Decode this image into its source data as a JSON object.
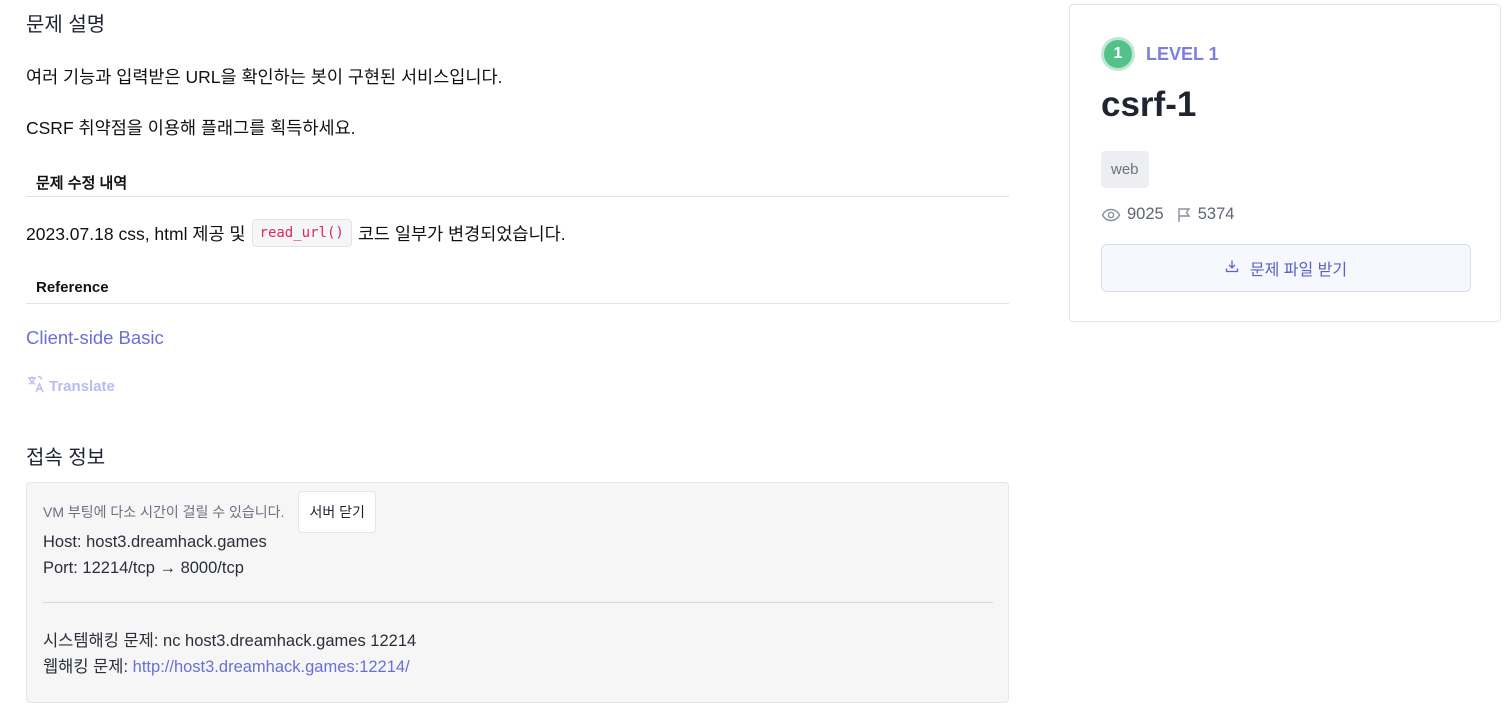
{
  "description": {
    "heading": "문제 설명",
    "line1": "여러 기능과 입력받은 URL을 확인하는 봇이 구현된 서비스입니다.",
    "line2": "CSRF 취약점을 이용해 플래그를 획득하세요."
  },
  "revision": {
    "heading": "문제 수정 내역",
    "text_before": "2023.07.18 css, html 제공 및",
    "code": "read_url()",
    "text_after": "코드 일부가 변경되었습니다."
  },
  "reference": {
    "heading": "Reference",
    "link_label": "Client-side Basic"
  },
  "translate_label": "Translate",
  "connection": {
    "heading": "접속 정보",
    "vm_note": "VM 부팅에 다소 시간이 걸릴 수 있습니다.",
    "close_button": "서버 닫기",
    "host": "Host: host3.dreamhack.games",
    "port": "Port:  12214/tcp → 8000/tcp",
    "system_hacking": "시스템해킹 문제: nc host3.dreamhack.games 12214",
    "web_hacking_label": "웹해킹 문제:",
    "web_hacking_url": "http://host3.dreamhack.games:12214/"
  },
  "sidebar": {
    "level_number": "1",
    "level_label": "LEVEL 1",
    "title": "csrf-1",
    "tag": "web",
    "views": "9025",
    "solves": "5374",
    "download_button": "문제 파일 받기"
  },
  "colors": {
    "accent": "#6a6fd8",
    "level_green": "#54c08a",
    "code_red": "#e0245e"
  },
  "icons": [
    "translate-icon",
    "eye-icon",
    "flag-icon",
    "download-icon"
  ]
}
